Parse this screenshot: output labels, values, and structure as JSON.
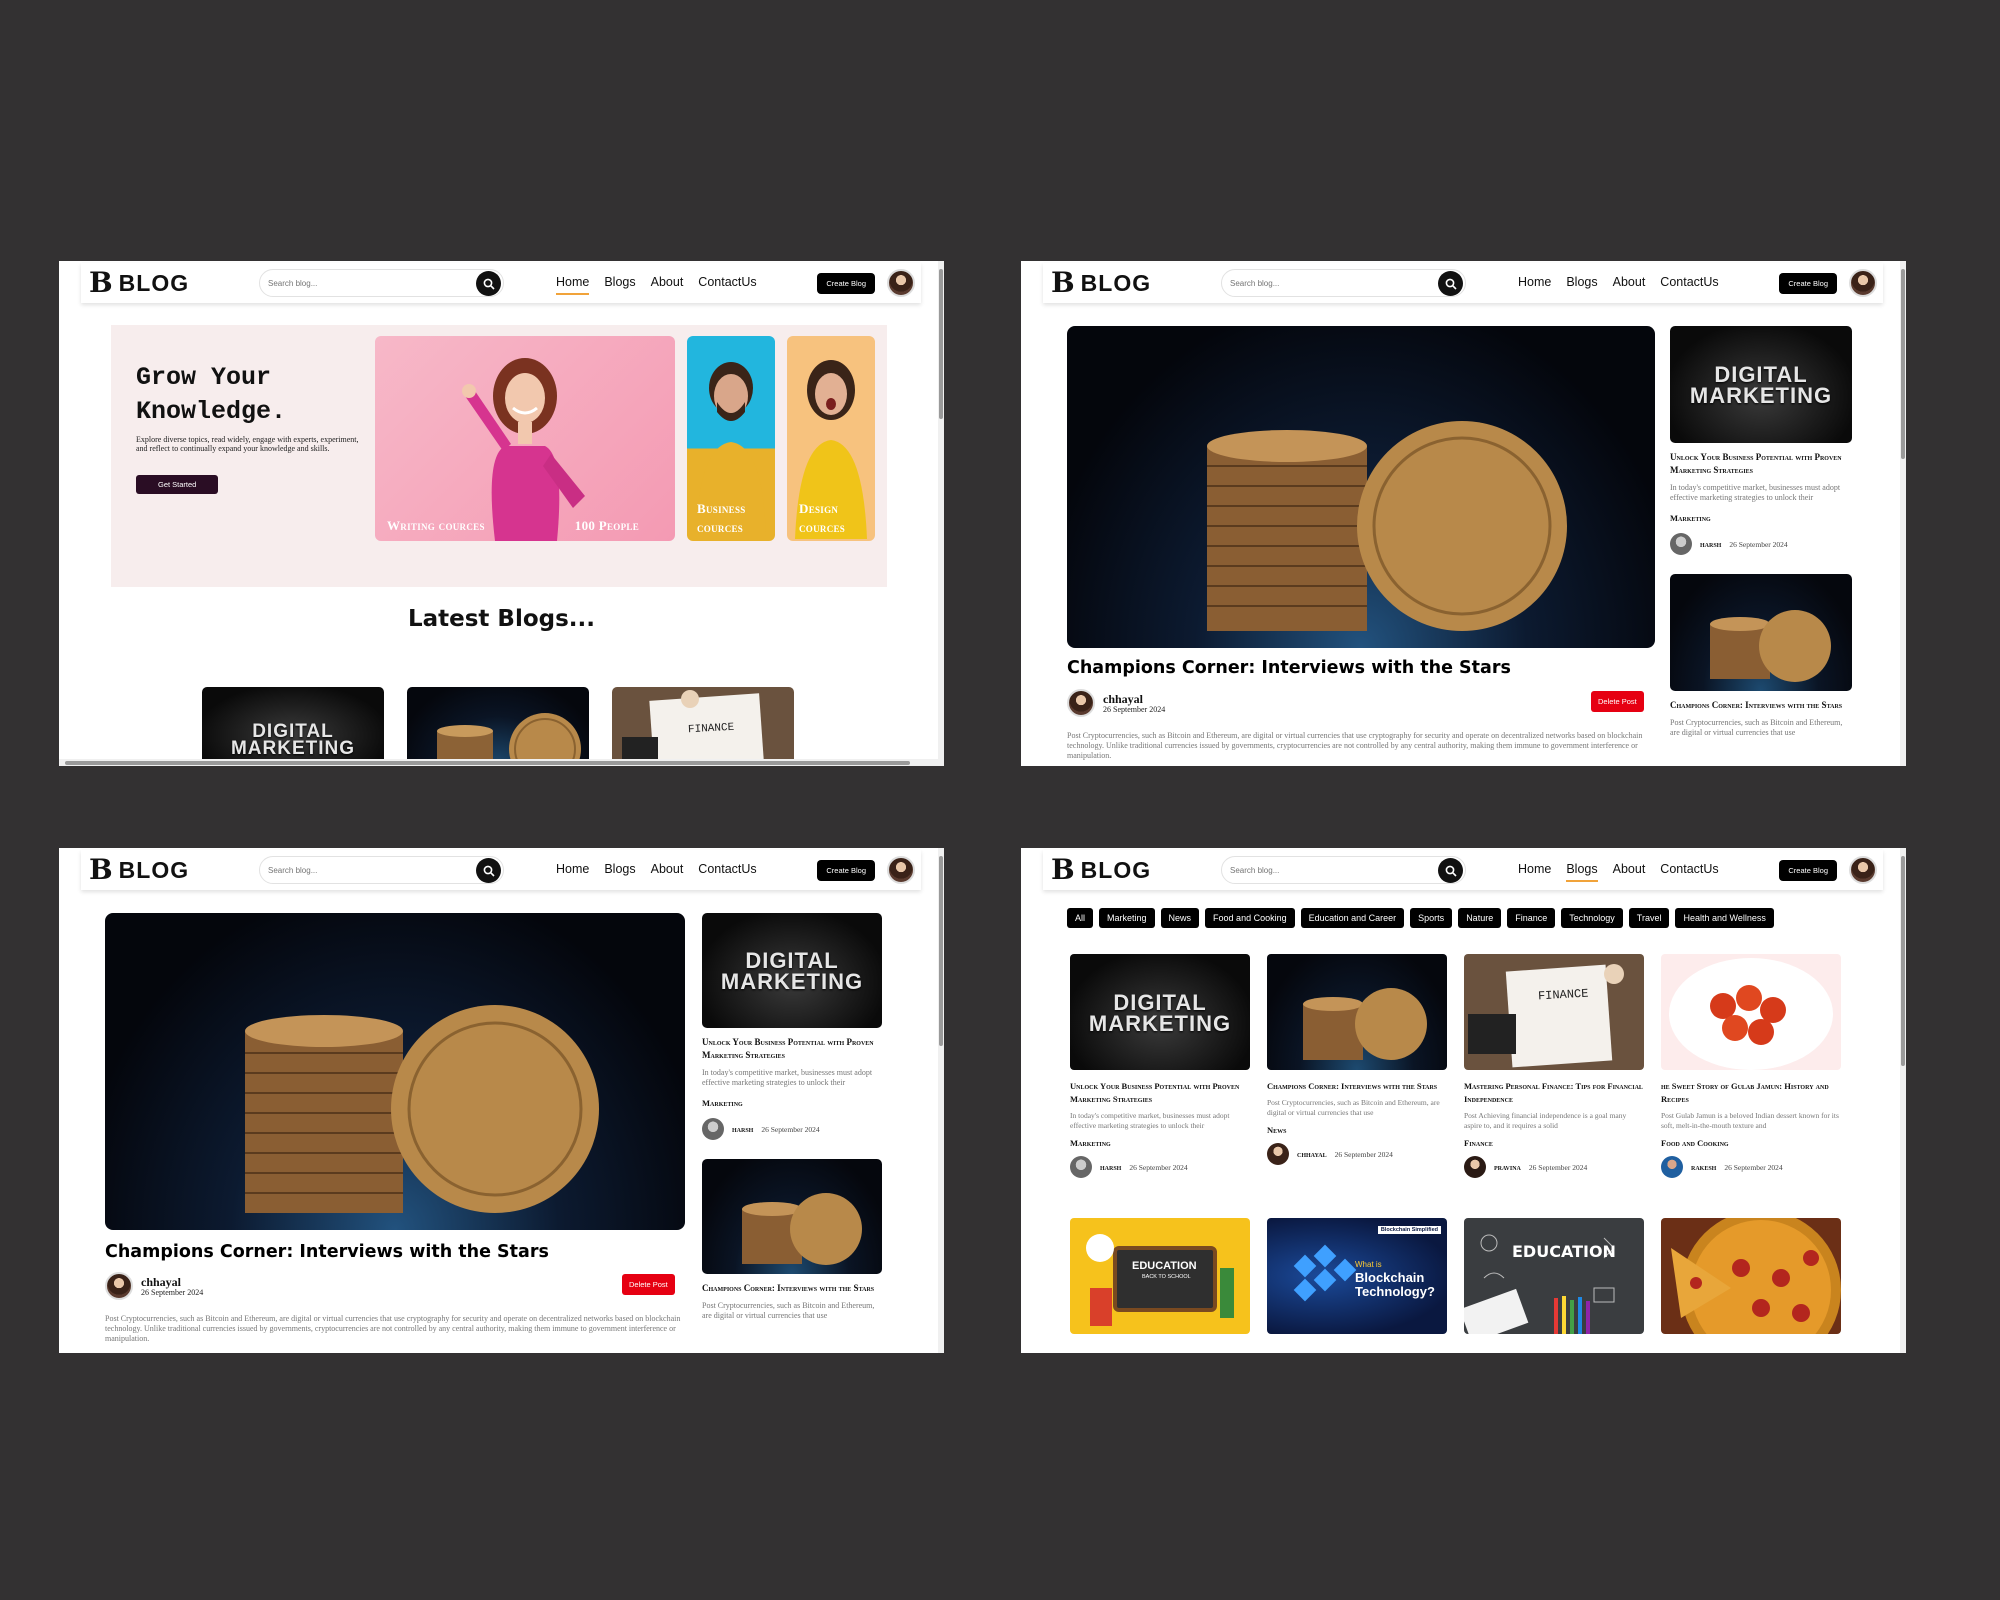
{
  "brand": {
    "mark": "B",
    "name": "BLOG"
  },
  "search": {
    "placeholder": "Search blog..."
  },
  "nav": {
    "home": "Home",
    "blogs": "Blogs",
    "about": "About",
    "contact": "ContactUs",
    "create": "Create Blog"
  },
  "hero": {
    "title": "Grow Your Knowledge.",
    "text": "Explore diverse topics, read widely, engage with experts, experiment, and reflect to continually expand your knowledge and skills.",
    "cta": "Get Started",
    "card1_left": "Writing cources",
    "card1_right": "100 People",
    "card2": "Business cources",
    "card3": "Design cources"
  },
  "latest": {
    "heading": "Latest Blogs..."
  },
  "thumbs": {
    "digital_line1": "DIGITAL",
    "digital_line2": "MARKETING",
    "finance": "FINANCE"
  },
  "post": {
    "title": "Champions Corner: Interviews with the Stars",
    "author": "chhayal",
    "date": "26 September 2024",
    "delete": "Delete Post",
    "body": "Post Cryptocurrencies, such as Bitcoin and Ethereum, are digital or virtual currencies that use cryptography for security and operate on decentralized networks based on blockchain technology. Unlike traditional currencies issued by governments, cryptocurrencies are not controlled by any central authority, making them immune to government interference or manipulation."
  },
  "side": [
    {
      "title": "Unlock Your Business Potential with Proven Marketing Strategies",
      "excerpt": "In today's competitive market, businesses must adopt effective marketing strategies to unlock their",
      "category": "Marketing",
      "author": "harsh",
      "date": "26 September 2024"
    },
    {
      "title": "Champions Corner: Interviews with the Stars",
      "excerpt": "Post Cryptocurrencies, such as Bitcoin and Ethereum, are digital or virtual currencies that use"
    }
  ],
  "categories": [
    "All",
    "Marketing",
    "News",
    "Food and Cooking",
    "Education and Career",
    "Sports",
    "Nature",
    "Finance",
    "Technology",
    "Travel",
    "Health and Wellness"
  ],
  "grid": [
    {
      "title": "Unlock Your Business Potential with Proven Marketing Strategies",
      "excerpt": "In today's competitive market, businesses must adopt effective marketing strategies to unlock their",
      "category": "Marketing",
      "author": "harsh",
      "date": "26 September 2024"
    },
    {
      "title": "Champions Corner: Interviews with the Stars",
      "excerpt": "Post Cryptocurrencies, such as Bitcoin and Ethereum, are digital or virtual currencies that use",
      "category": "News",
      "author": "chhayal",
      "date": "26 September 2024"
    },
    {
      "title": "Mastering Personal Finance: Tips for Financial Independence",
      "excerpt": "Post Achieving financial independence is a goal many aspire to, and it requires a solid",
      "category": "Finance",
      "author": "pravina",
      "date": "26 September 2024"
    },
    {
      "title": "he Sweet Story of Gulab Jamun: History and Recipes",
      "excerpt": "Post Gulab Jamun is a beloved Indian dessert known for its soft, melt-in-the-mouth texture and",
      "category": "Food and Cooking",
      "author": "rakesh",
      "date": "26 September 2024"
    }
  ],
  "grid2": {
    "education1": "EDUCATION",
    "education1_sub": "BACK TO SCHOOL",
    "blockchain_tag": "Blockchain Simplified",
    "blockchain_pre": "What is",
    "blockchain_1": "Blockchain",
    "blockchain_2": "Technology?",
    "education2": "EDUCATION"
  }
}
